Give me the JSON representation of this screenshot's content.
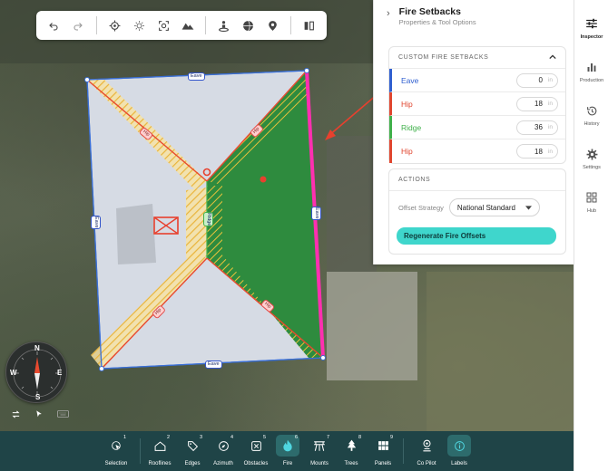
{
  "toolbar": {
    "icons": [
      "undo-icon",
      "redo-icon",
      "target-icon",
      "sun-icon",
      "focus-icon",
      "terrain-icon",
      "person-pin-icon",
      "globe-icon",
      "map-pin-icon",
      "split-view-icon"
    ]
  },
  "map": {
    "labels": {
      "eave_top": "Eave",
      "eave_bottom": "Eave",
      "eave_left": "Eave",
      "eave_right": "Eave",
      "ridge": "Ridge",
      "hip_1": "Hip",
      "hip_2": "Hip",
      "hip_3": "Hip",
      "hip_4": "Hip"
    },
    "colors": {
      "setback_highlight": "#ff2fb0",
      "fire_zone": "#2e8b3e",
      "hatch": "#f4c64a",
      "hip_line": "#e84a2f",
      "edge": "#3a6fd6"
    }
  },
  "compass": {
    "n": "N",
    "s": "S",
    "e": "E",
    "w": "W"
  },
  "panel": {
    "title": "Fire Setbacks",
    "subtitle": "Properties & Tool Options",
    "setbacks": {
      "header": "CUSTOM FIRE SETBACKS",
      "rows": [
        {
          "label": "Eave",
          "value": "0",
          "unit": "in",
          "color": "#2f5fd0"
        },
        {
          "label": "Hip",
          "value": "18",
          "unit": "in",
          "color": "#e0452e"
        },
        {
          "label": "Ridge",
          "value": "36",
          "unit": "in",
          "color": "#3fb04a"
        },
        {
          "label": "Hip",
          "value": "18",
          "unit": "in",
          "color": "#e0452e"
        }
      ]
    },
    "actions": {
      "header": "ACTIONS",
      "strategy_label": "Offset Strategy",
      "strategy_value": "National Standard",
      "regenerate_label": "Regenerate Fire Offsets"
    }
  },
  "sidebar": {
    "items": [
      {
        "label": "Inspector",
        "icon": "sliders-icon",
        "active": true
      },
      {
        "label": "Production",
        "icon": "bar-chart-icon",
        "active": false
      },
      {
        "label": "History",
        "icon": "history-icon",
        "active": false
      },
      {
        "label": "Settings",
        "icon": "gear-icon",
        "active": false
      },
      {
        "label": "Hub",
        "icon": "grid-icon",
        "active": false
      }
    ]
  },
  "bottombar": {
    "items": [
      {
        "label": "Selection",
        "num": "1",
        "icon": "cursor-icon"
      },
      {
        "label": "Rooflines",
        "num": "2",
        "icon": "roof-icon"
      },
      {
        "label": "Edges",
        "num": "3",
        "icon": "tag-icon"
      },
      {
        "label": "Azimuth",
        "num": "4",
        "icon": "compass-icon"
      },
      {
        "label": "Obstacles",
        "num": "5",
        "icon": "obstacle-icon"
      },
      {
        "label": "Fire",
        "num": "6",
        "icon": "flame-icon",
        "active": true
      },
      {
        "label": "Mounts",
        "num": "7",
        "icon": "mount-icon"
      },
      {
        "label": "Trees",
        "num": "8",
        "icon": "tree-icon"
      },
      {
        "label": "Panels",
        "num": "9",
        "icon": "panels-icon"
      },
      {
        "label": "Co Pilot",
        "num": "",
        "icon": "copilot-icon"
      },
      {
        "label": "Labels",
        "num": "",
        "icon": "info-icon",
        "active": true
      }
    ]
  }
}
